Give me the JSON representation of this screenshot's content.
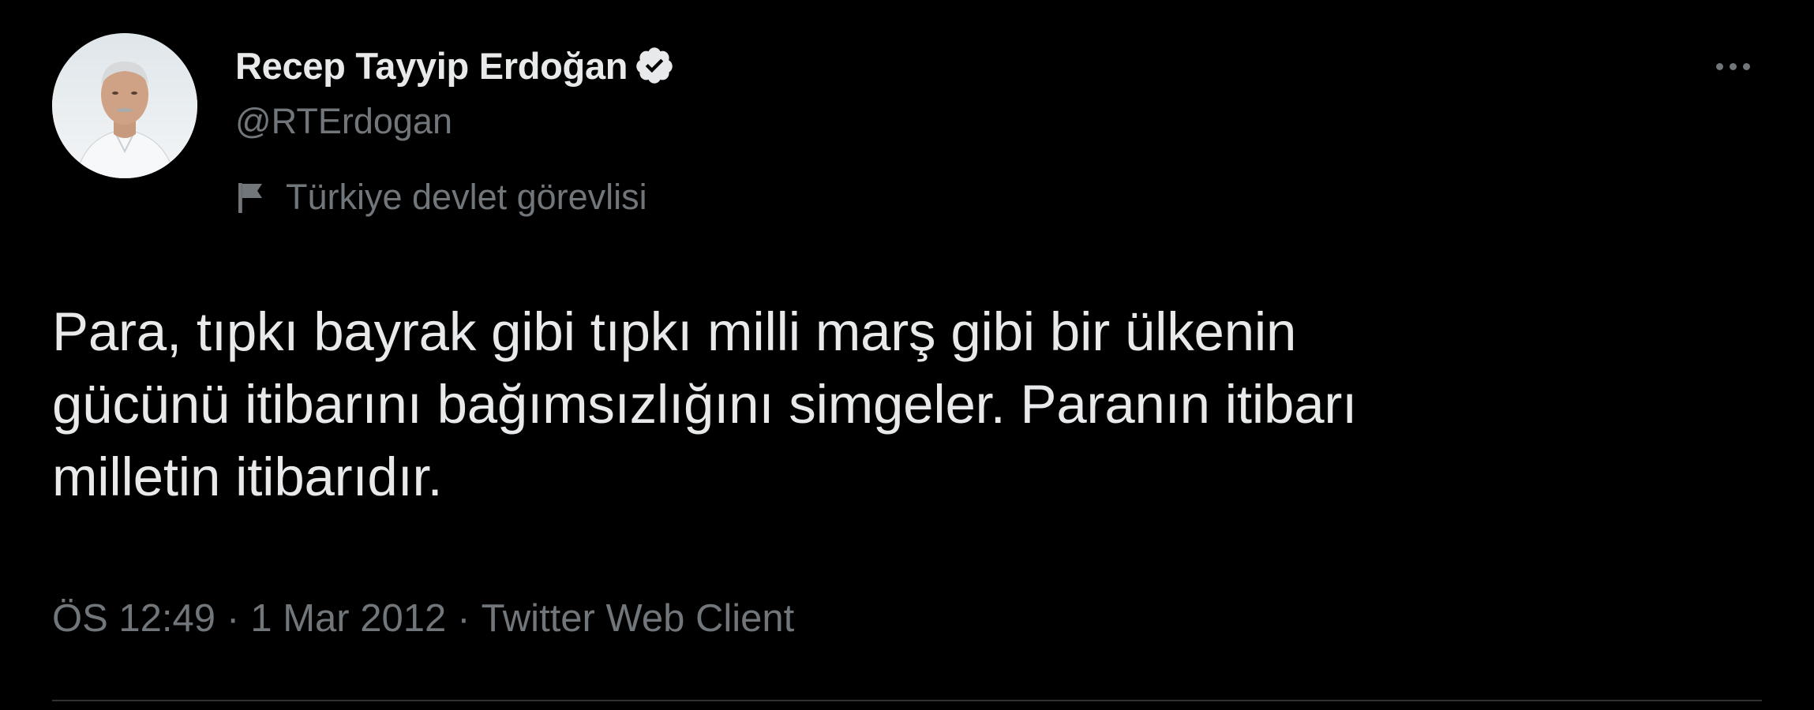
{
  "user": {
    "display_name": "Recep Tayyip Erdoğan",
    "handle": "@RTErdogan",
    "label": "Türkiye devlet görevlisi",
    "avatar_icon": "profile-photo",
    "verified_icon": "verified-badge-icon",
    "label_icon": "flag-icon"
  },
  "tweet": {
    "text": "Para, tıpkı bayrak gibi tıpkı milli marş gibi bir ülkenin\ngücünü itibarını bağımsızlığını simgeler. Paranın itibarı\nmilletin itibarıdır.",
    "time": "ÖS 12:49",
    "separator_1": "·",
    "date": "1 Mar 2012",
    "separator_2": "·",
    "source": "Twitter Web Client"
  },
  "actions": {
    "more_icon": "more-options-icon"
  },
  "colors": {
    "background": "#000000",
    "text_primary": "#e7e9ea",
    "text_secondary": "#71767b",
    "divider": "#2f3336"
  }
}
